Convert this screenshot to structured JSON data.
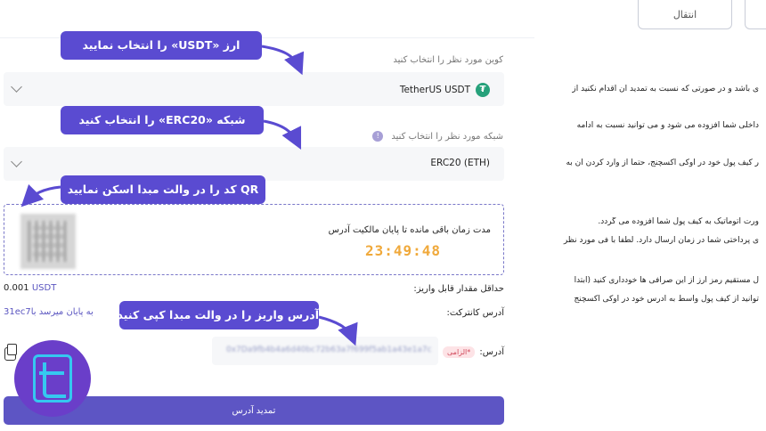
{
  "top_tabs": [
    {
      "label": "انتقال"
    },
    {
      "label": ""
    }
  ],
  "coin": {
    "label": "کوین مورد نظر را انتخاب کنید",
    "value": "TetherUS USDT",
    "icon": "tether-icon"
  },
  "network": {
    "label": "شبکه مورد نظر را انتخاب کنید",
    "value": "ERC20 (ETH)"
  },
  "qr_panel": {
    "timer_label": "مدت زمان باقی مانده تا پایان مالکیت آدرس",
    "timer": "23:49:48"
  },
  "min_deposit": {
    "label": "حداقل مقدار قابل واریز:",
    "value": "0.001",
    "unit": "USDT"
  },
  "contract": {
    "label": "آدرس کانترکت:",
    "value": "به پایان میرسد با31ec7"
  },
  "address": {
    "label": "آدرس:",
    "required_badge": "الزامی*",
    "value": "0x7Da9fb4b4a6d40bc72b63a7f699f5ab1a43e1a7c"
  },
  "submit_label": "تمدید آدرس",
  "callouts": [
    "ارز «USDT» را انتخاب نمایید",
    "شبکه «ERC20» را انتخاب کنید",
    "QR کد را در والت مبدا  اسکن نمایید",
    "آدرس واریز را در والت مبدا کپی کنید"
  ],
  "side_text": [
    "ی باشد و در صورتی که نسبت به تمدید آن اقدام نکنید از",
    "داخلی شما افزوده می شود و می توانید نسبت به ادامه",
    "ر کیف پول خود در اوکی اکسچنج، حتما از وارد کردن آن به",
    "ورت اتوماتیک به کیف پول شما افزوده می گردد.",
    "ی پرداختی شما در زمان ارسال دارد. لطفا با فی مورد نظر",
    "ل مستقیم رمز ارز از این صرافی ها خودداری کنید (ابتدا",
    "توانید از کیف پول واسط به ادرس خود در اوکی اکسچنج"
  ],
  "colors": {
    "accent": "#5a4bd1",
    "button": "#5d55c4",
    "timer": "#f0a93b",
    "tether": "#26a17b"
  }
}
